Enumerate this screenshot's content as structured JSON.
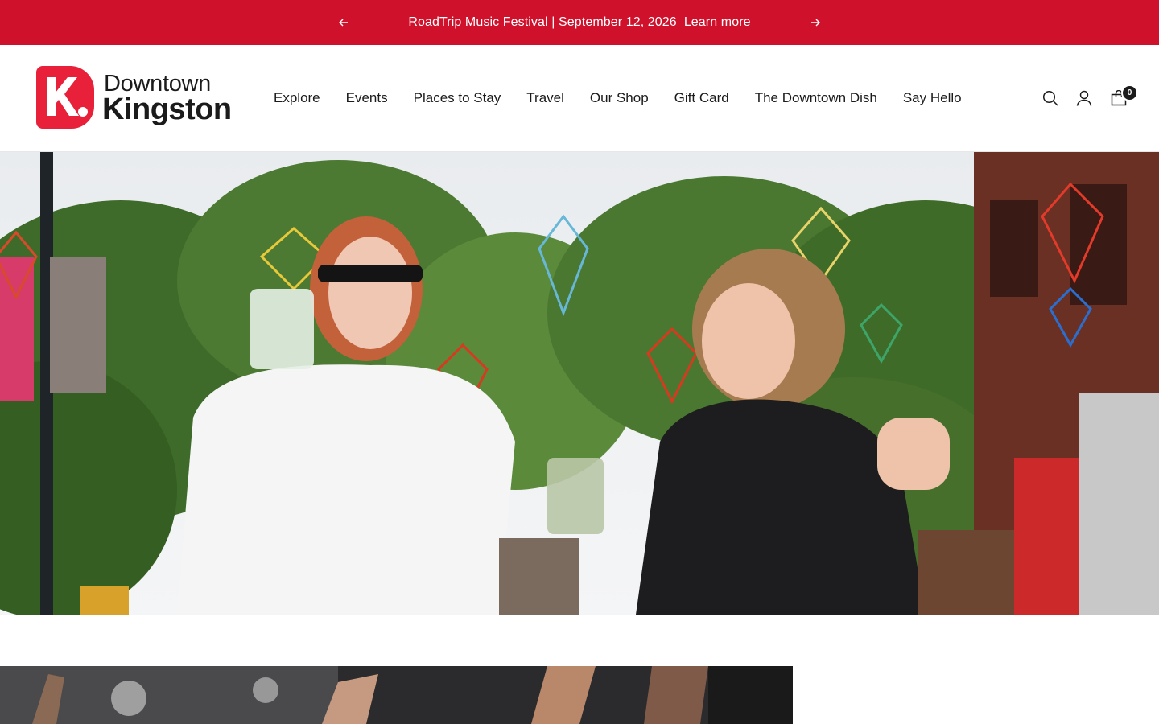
{
  "announcement": {
    "message": "RoadTrip Music Festival | September 12, 2026",
    "link_label": "Learn more",
    "prev_icon": "arrow-left-icon",
    "next_icon": "arrow-right-icon",
    "background": "#d0112b"
  },
  "header": {
    "logo": {
      "mark_letter": "K.",
      "line1": "Downtown",
      "line2": "Kingston",
      "brand_color": "#e8203a"
    },
    "nav": [
      {
        "label": "Explore"
      },
      {
        "label": "Events"
      },
      {
        "label": "Places to Stay"
      },
      {
        "label": "Travel"
      },
      {
        "label": "Our Shop"
      },
      {
        "label": "Gift Card"
      },
      {
        "label": "The Downtown Dish"
      },
      {
        "label": "Say Hello"
      }
    ],
    "icons": {
      "search": "search-icon",
      "account": "user-icon",
      "cart": "cart-icon"
    },
    "cart_count": "0"
  },
  "hero": {
    "image": "two women laughing and dancing with drinks at an outdoor street festival under colorful hanging lanterns"
  },
  "lower_image": {
    "image": "crowd with raised hands at a concert"
  }
}
